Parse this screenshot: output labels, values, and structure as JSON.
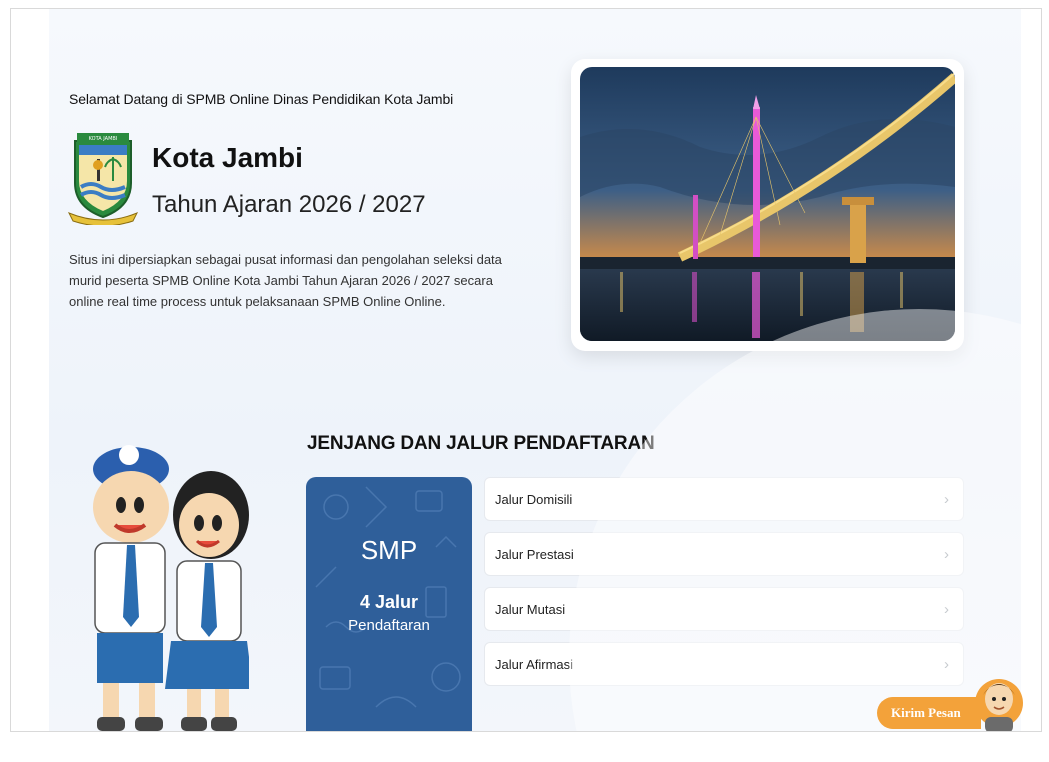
{
  "hero": {
    "welcome": "Selamat Datang di SPMB Online Dinas Pendidikan Kota Jambi",
    "city": "Kota Jambi",
    "year": "Tahun Ajaran 2026 / 2027",
    "description": "Situs ini dipersiapkan sebagai pusat informasi dan pengolahan seleksi data murid peserta SPMB Online Kota Jambi Tahun Ajaran 2026 / 2027 secara online real time process untuk pelaksanaan SPMB Online Online.",
    "logo_text": "KOTA JAMBI"
  },
  "section": {
    "title": "JENJANG DAN JALUR PENDAFTARAN"
  },
  "level": {
    "name": "SMP",
    "count": "4 Jalur",
    "caption": "Pendaftaran"
  },
  "routes": [
    {
      "label": "Jalur Domisili"
    },
    {
      "label": "Jalur Prestasi"
    },
    {
      "label": "Jalur Mutasi"
    },
    {
      "label": "Jalur Afirmasi"
    }
  ],
  "chat": {
    "label": "Kirim Pesan"
  },
  "colors": {
    "level_card": "#2f5f9a",
    "chat_button": "#f3a23a",
    "background": "#f3f6fb"
  },
  "icons": {
    "route_chevron": "chevron-right-icon"
  }
}
